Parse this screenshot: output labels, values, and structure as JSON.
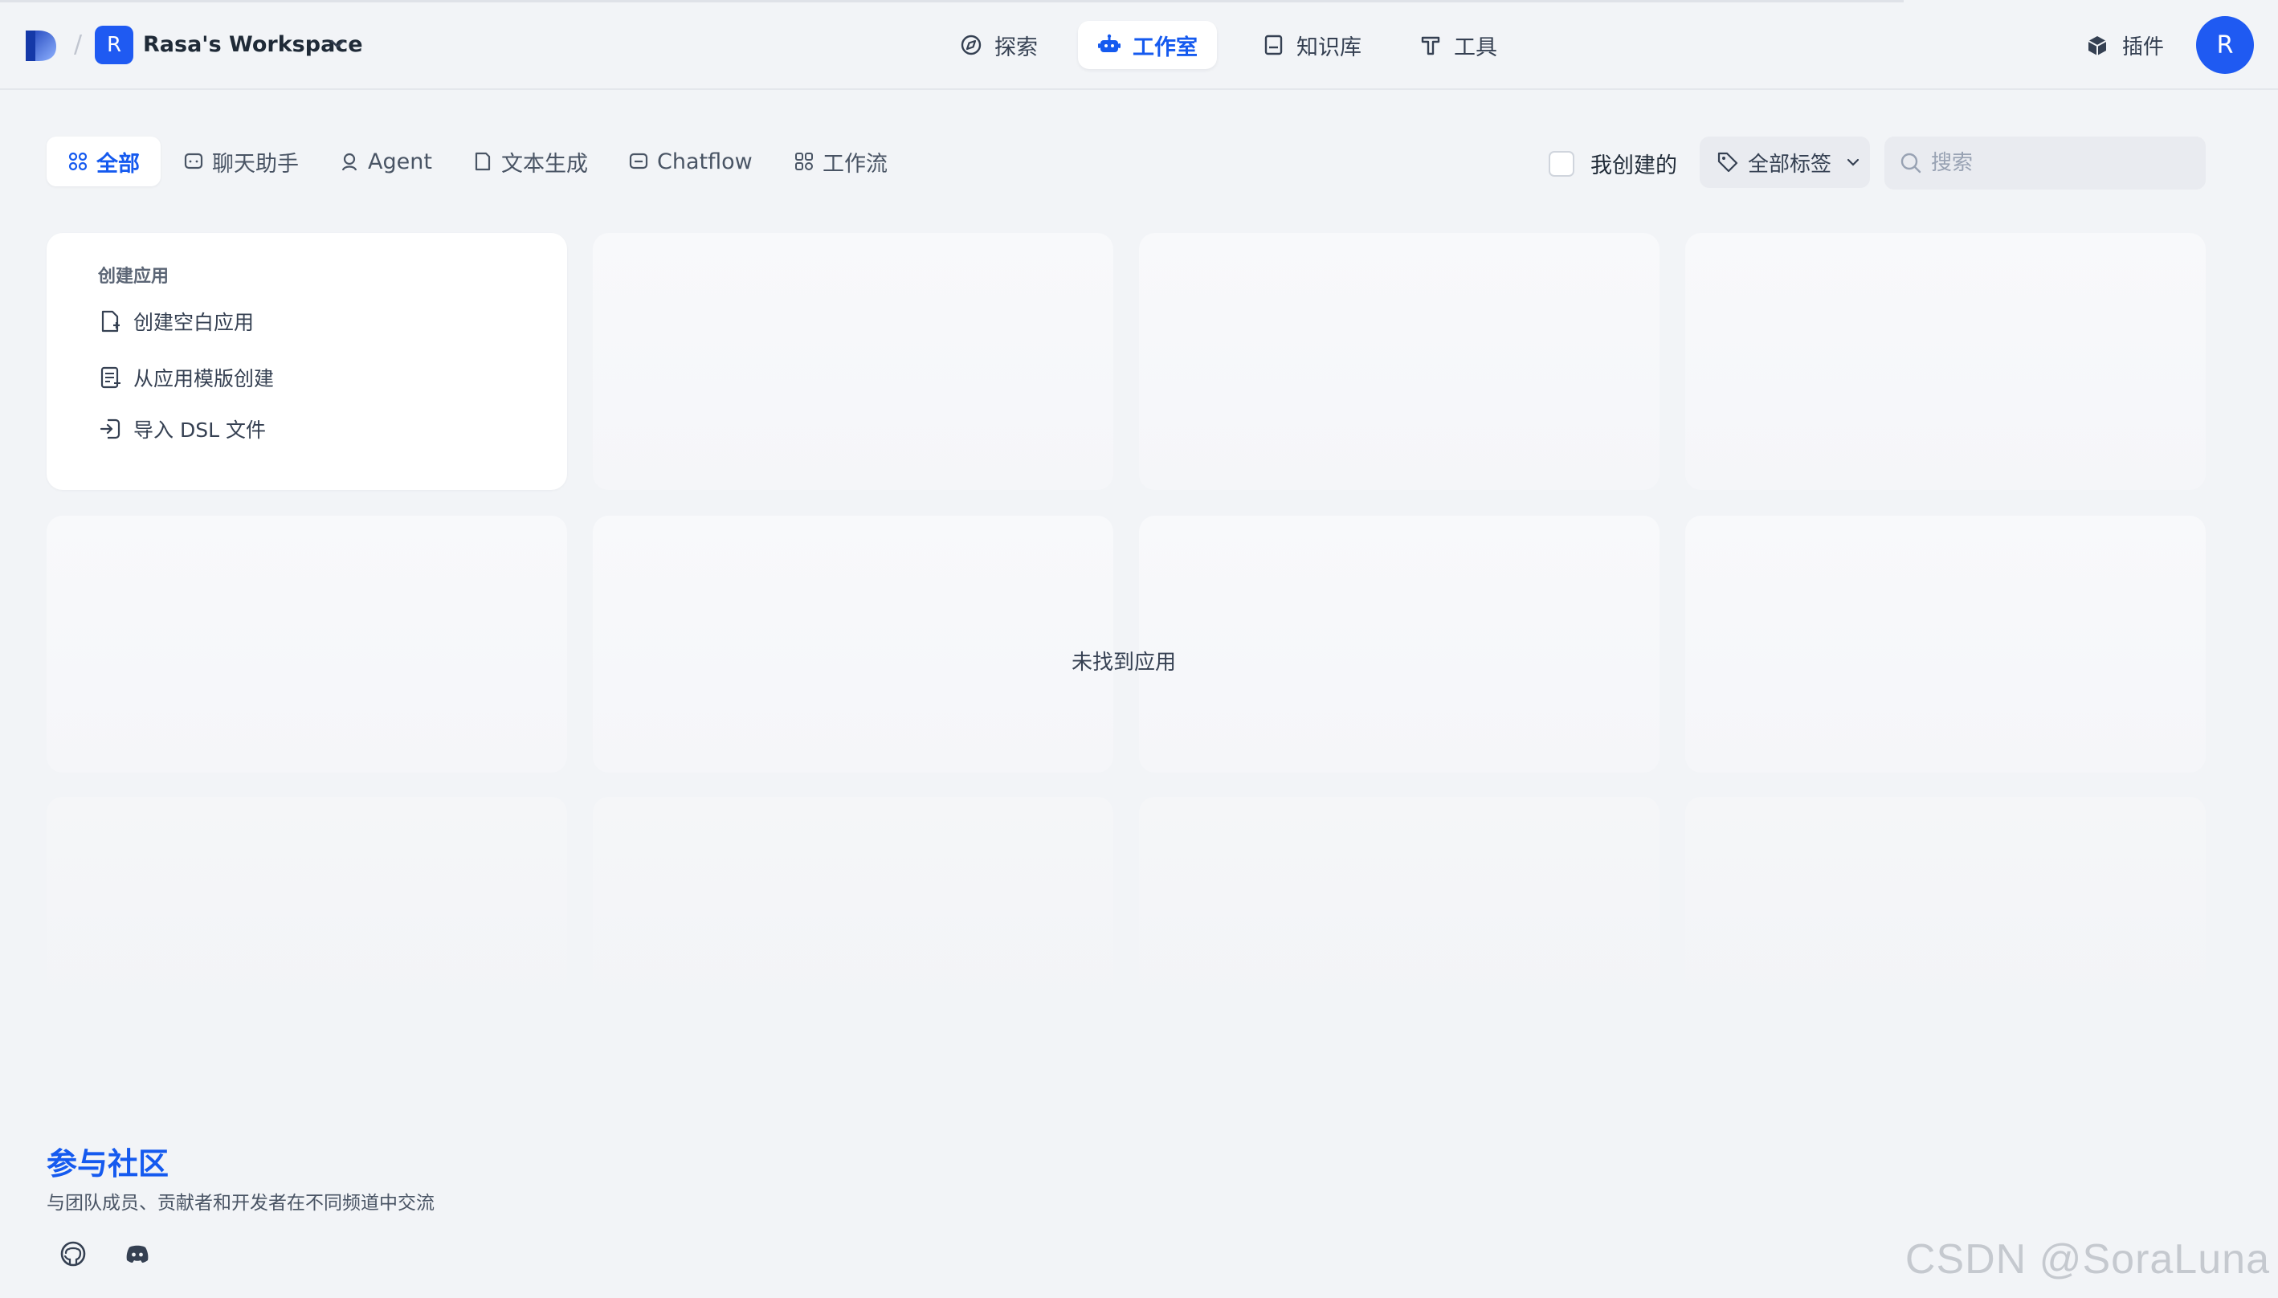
{
  "header": {
    "slash": "/",
    "workspace_initial": "R",
    "workspace_name": "Rasa's Workspace",
    "nav": [
      {
        "label": "探索",
        "icon": "compass-icon"
      },
      {
        "label": "工作室",
        "icon": "robot-icon",
        "active": true
      },
      {
        "label": "知识库",
        "icon": "book-icon"
      },
      {
        "label": "工具",
        "icon": "hammer-icon"
      }
    ],
    "plugin_label": "插件",
    "user_initial": "R"
  },
  "filters": {
    "tabs": [
      {
        "label": "全部",
        "icon": "grid-icon",
        "active": true
      },
      {
        "label": "聊天助手",
        "icon": "chat-icon"
      },
      {
        "label": "Agent",
        "icon": "agent-icon"
      },
      {
        "label": "文本生成",
        "icon": "document-icon"
      },
      {
        "label": "Chatflow",
        "icon": "chatflow-icon"
      },
      {
        "label": "工作流",
        "icon": "workflow-icon"
      }
    ],
    "mine_label": "我创建的",
    "tag_label": "全部标签",
    "search_placeholder": "搜索"
  },
  "create_card": {
    "title": "创建应用",
    "items": [
      {
        "label": "创建空白应用",
        "icon": "file-plus-icon"
      },
      {
        "label": "从应用模版创建",
        "icon": "template-icon"
      },
      {
        "label": "导入 DSL 文件",
        "icon": "import-icon"
      }
    ]
  },
  "empty_state": "未找到应用",
  "community": {
    "title": "参与社区",
    "description": "与团队成员、贡献者和开发者在不同频道中交流",
    "links": [
      "github-icon",
      "discord-icon"
    ]
  },
  "watermark": "CSDN @SoraLuna",
  "colors": {
    "accent": "#155aef",
    "background": "#f2f4f7",
    "avatar": "#1f5af2"
  }
}
